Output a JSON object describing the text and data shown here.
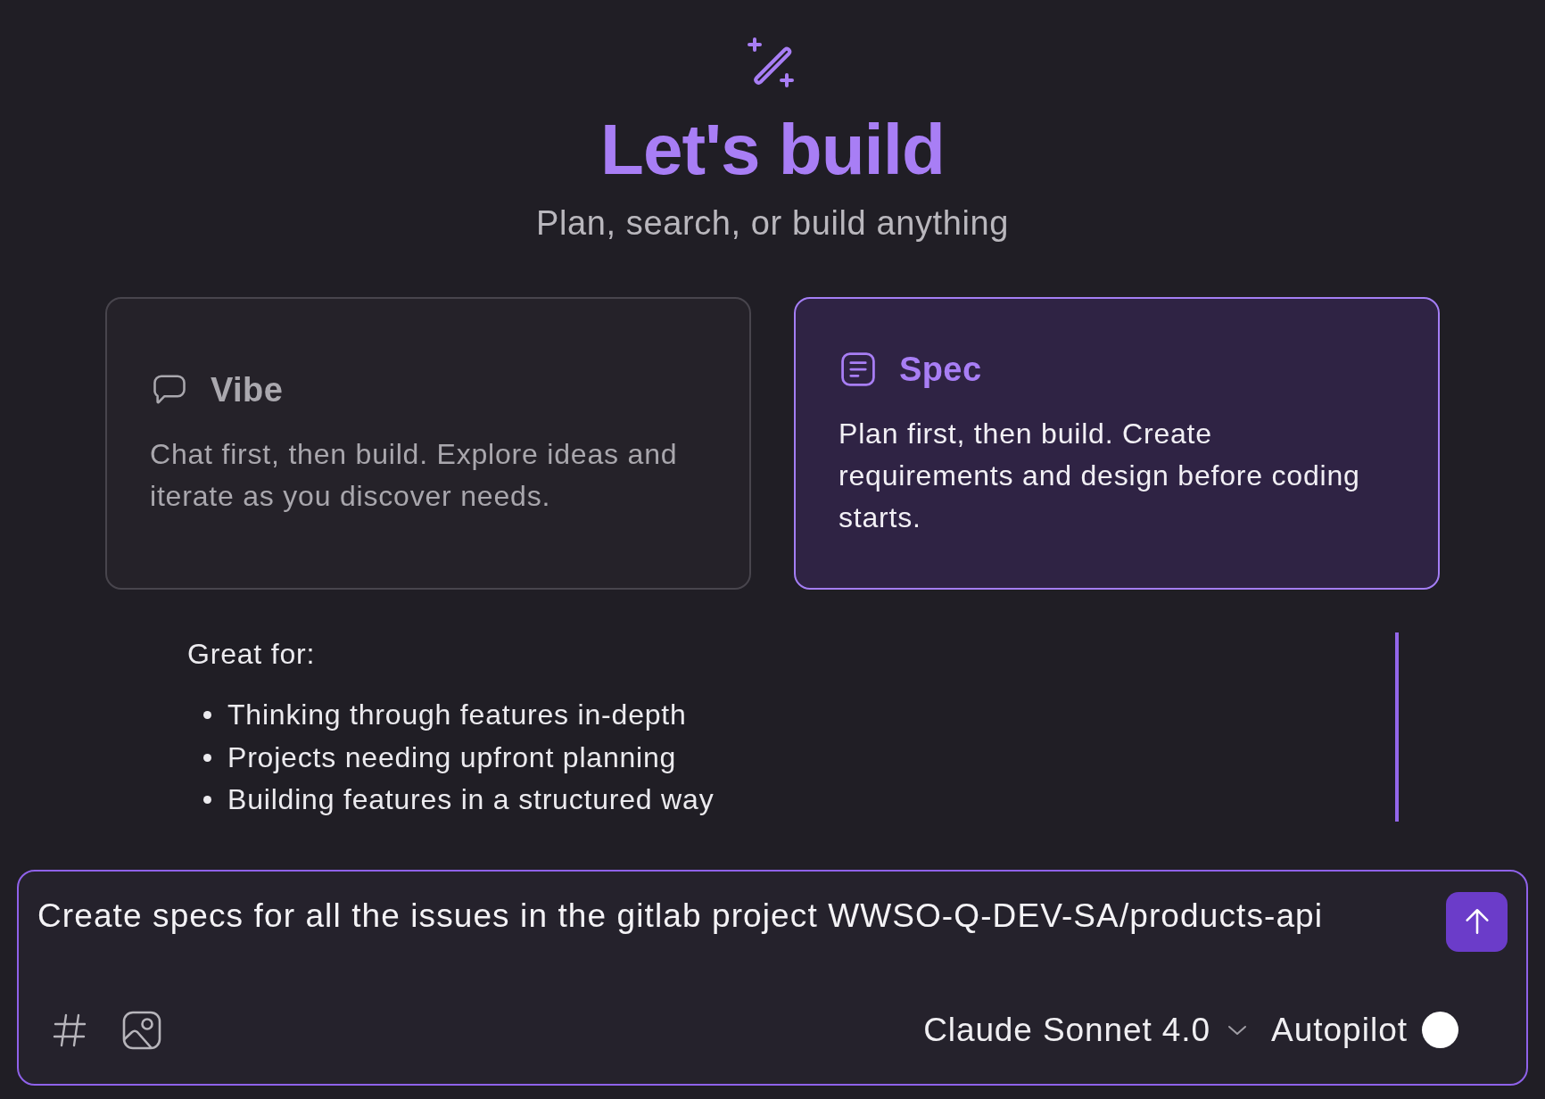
{
  "header": {
    "title": "Let's build",
    "subtitle": "Plan, search, or build anything"
  },
  "modes": [
    {
      "kind": "chat",
      "title": "Vibe",
      "description": "Chat first, then build. Explore ideas and iterate as you discover needs.",
      "selected": false
    },
    {
      "kind": "spec",
      "title": "Spec",
      "description": "Plan first, then build. Create requirements and design before coding starts.",
      "selected": true
    }
  ],
  "details": {
    "heading": "Great for:",
    "items": [
      "Thinking through features in-depth",
      "Projects needing upfront planning",
      "Building features in a structured way"
    ]
  },
  "composer": {
    "value": "Create specs for all the issues in the gitlab project WWSO-Q-DEV-SA/products-api",
    "model": "Claude Sonnet 4.0",
    "autopilot": {
      "label": "Autopilot",
      "on": false
    }
  }
}
